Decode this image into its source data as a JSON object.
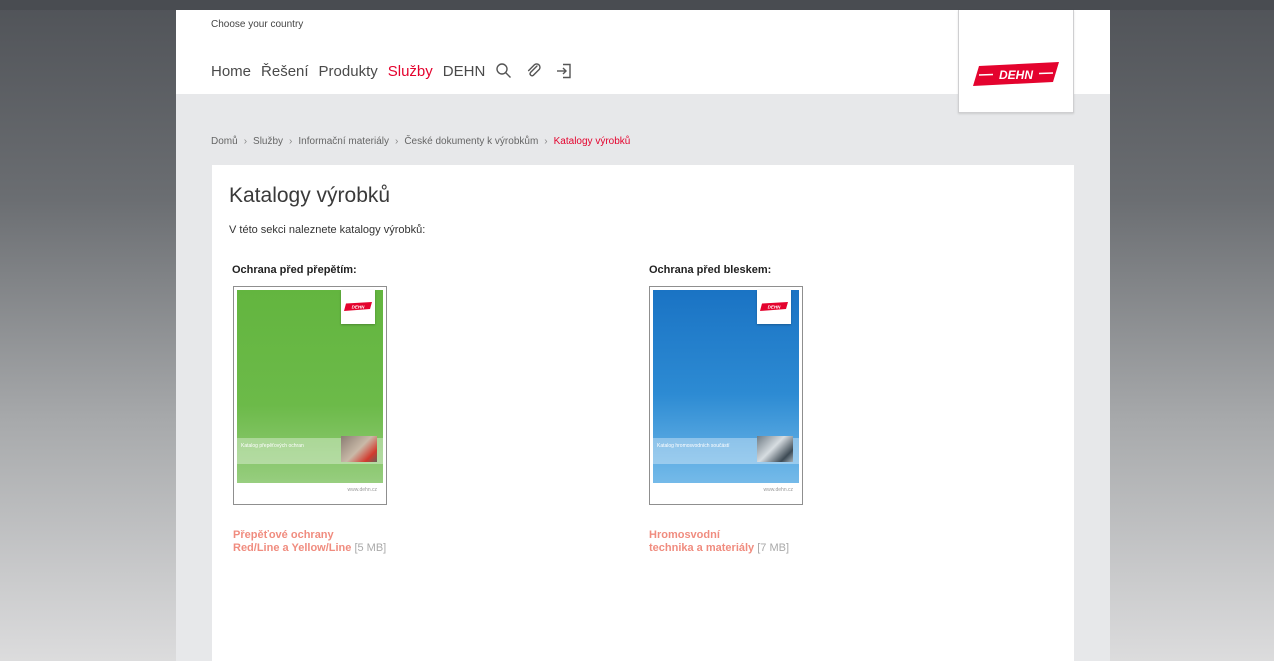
{
  "header": {
    "country_label": "Choose your country",
    "nav": [
      {
        "label": "Home",
        "active": false
      },
      {
        "label": "Řešení",
        "active": false
      },
      {
        "label": "Produkty",
        "active": false
      },
      {
        "label": "Služby",
        "active": true
      },
      {
        "label": "DEHN",
        "active": false
      }
    ],
    "icons": [
      "search-icon",
      "paperclip-icon",
      "login-icon"
    ],
    "logo_text": "DEHN"
  },
  "breadcrumb": [
    "Domů",
    "Služby",
    "Informační materiály",
    "České dokumenty k výrobkům",
    "Katalogy výrobků"
  ],
  "main": {
    "title": "Katalogy výrobků",
    "intro": "V této sekci naleznete katalogy výrobků:",
    "columns": [
      {
        "heading": "Ochrana před přepětím:",
        "cover_title": "Katalog přepěťových ochran",
        "cover_url": "www.dehn.cz",
        "link_line1": "Přepěťové ochrany",
        "link_line2": "Red/Line a Yellow/Line",
        "size": "[5 MB]"
      },
      {
        "heading": "Ochrana před bleskem:",
        "cover_title": "Katalog hromosvodních součástí",
        "cover_url": "www.dehn.cz",
        "link_line1": "Hromosvodní",
        "link_line2": "technika a materiály",
        "size": "[7 MB]"
      }
    ]
  },
  "colors": {
    "accent_red": "#e4032e",
    "link_pink": "#f08c7f",
    "cover_green": "#63b53f",
    "cover_blue": "#1a73c4"
  }
}
